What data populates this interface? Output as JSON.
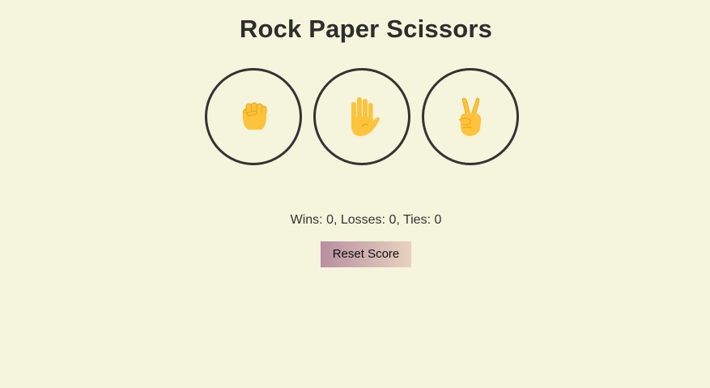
{
  "page": {
    "title": "Rock Paper Scissors"
  },
  "choices": [
    {
      "name": "rock",
      "icon": "fist-icon"
    },
    {
      "name": "paper",
      "icon": "raised-hand-icon"
    },
    {
      "name": "scissors",
      "icon": "victory-hand-icon"
    }
  ],
  "score": {
    "text": "Wins: 0, Losses: 0, Ties: 0"
  },
  "controls": {
    "reset_label": "Reset Score"
  },
  "colors": {
    "background": "#f5f4dc",
    "circle_border": "#333333",
    "hand_fill": "#fcc33b",
    "hand_shade": "#e8a516",
    "reset_gradient_start": "#b88fa1",
    "reset_gradient_end": "#e8d2c0"
  }
}
